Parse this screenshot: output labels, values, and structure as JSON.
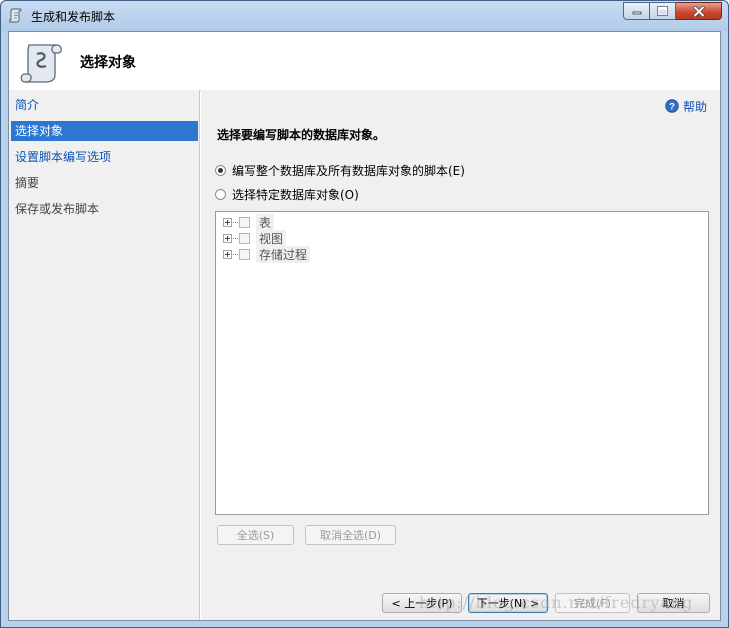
{
  "window": {
    "title": "生成和发布脚本",
    "controls": [
      "minimize-icon",
      "maximize-icon",
      "close-icon"
    ]
  },
  "header": {
    "title": "选择对象"
  },
  "nav": {
    "items": [
      {
        "label": "简介",
        "state": "link"
      },
      {
        "label": "选择对象",
        "state": "selected"
      },
      {
        "label": "设置脚本编写选项",
        "state": "link"
      },
      {
        "label": "摘要",
        "state": "plain"
      },
      {
        "label": "保存或发布脚本",
        "state": "plain"
      }
    ]
  },
  "main": {
    "help_label": "帮助",
    "heading": "选择要编写脚本的数据库对象。",
    "radio_all": {
      "label": "编写整个数据库及所有数据库对象的脚本(E)",
      "selected": true
    },
    "radio_specific": {
      "label": "选择特定数据库对象(O)",
      "selected": false
    },
    "tree_items": [
      "表",
      "视图",
      "存储过程"
    ],
    "select_all_label": "全选(S)",
    "deselect_all_label": "取消全选(D)"
  },
  "footer": {
    "prev_label": "< 上一步(P)",
    "next_label": "下一步(N) >",
    "finish_label": "完成(F)",
    "cancel_label": "取消"
  },
  "watermark": "http://blog.csdn.net/fredryang",
  "colors": {
    "accent": "#2d77d1",
    "link": "#0b54b8",
    "panel": "#f0f0f0",
    "titlebar": "#b9d1ea"
  }
}
